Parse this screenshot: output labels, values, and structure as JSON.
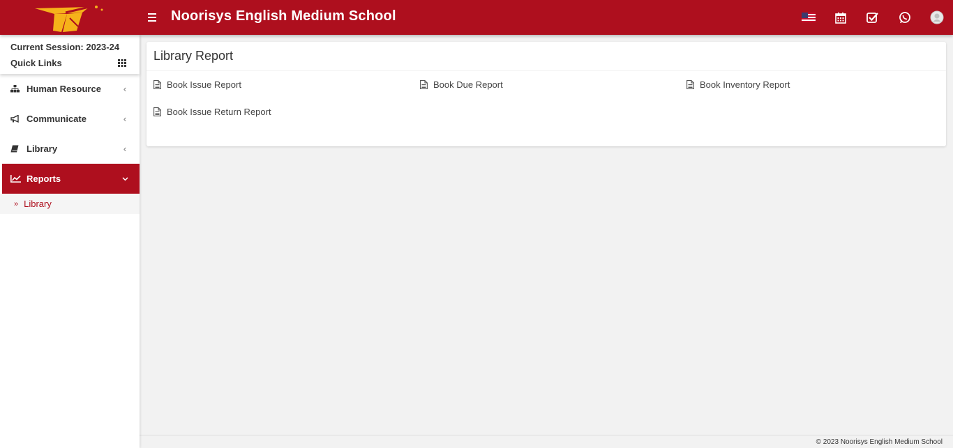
{
  "header": {
    "school_name": "Noorisys English Medium School",
    "icons": [
      "flag-us-icon",
      "calendar-icon",
      "check-square-icon",
      "whatsapp-icon",
      "user-avatar-icon"
    ],
    "brand_color": "#ae0f1e"
  },
  "sidebar": {
    "session_label": "Current Session: 2023-24",
    "quick_links_label": "Quick Links",
    "items": [
      {
        "label": "Human Resource",
        "icon": "sitemap-icon",
        "arrow": "‹"
      },
      {
        "label": "Communicate",
        "icon": "bullhorn-icon",
        "arrow": "‹"
      },
      {
        "label": "Library",
        "icon": "book-icon",
        "arrow": "‹"
      },
      {
        "label": "Reports",
        "icon": "line-chart-icon",
        "arrow": "⌄",
        "active": true
      }
    ],
    "submenu": [
      {
        "label": "Library",
        "icon": "angle-double-right-icon"
      }
    ]
  },
  "main": {
    "title": "Library Report",
    "reports": [
      "Book Issue Report",
      "Book Due Report",
      "Book Inventory Report",
      "Book Issue Return Report"
    ]
  },
  "footer": {
    "text": "© 2023 Noorisys English Medium School"
  }
}
